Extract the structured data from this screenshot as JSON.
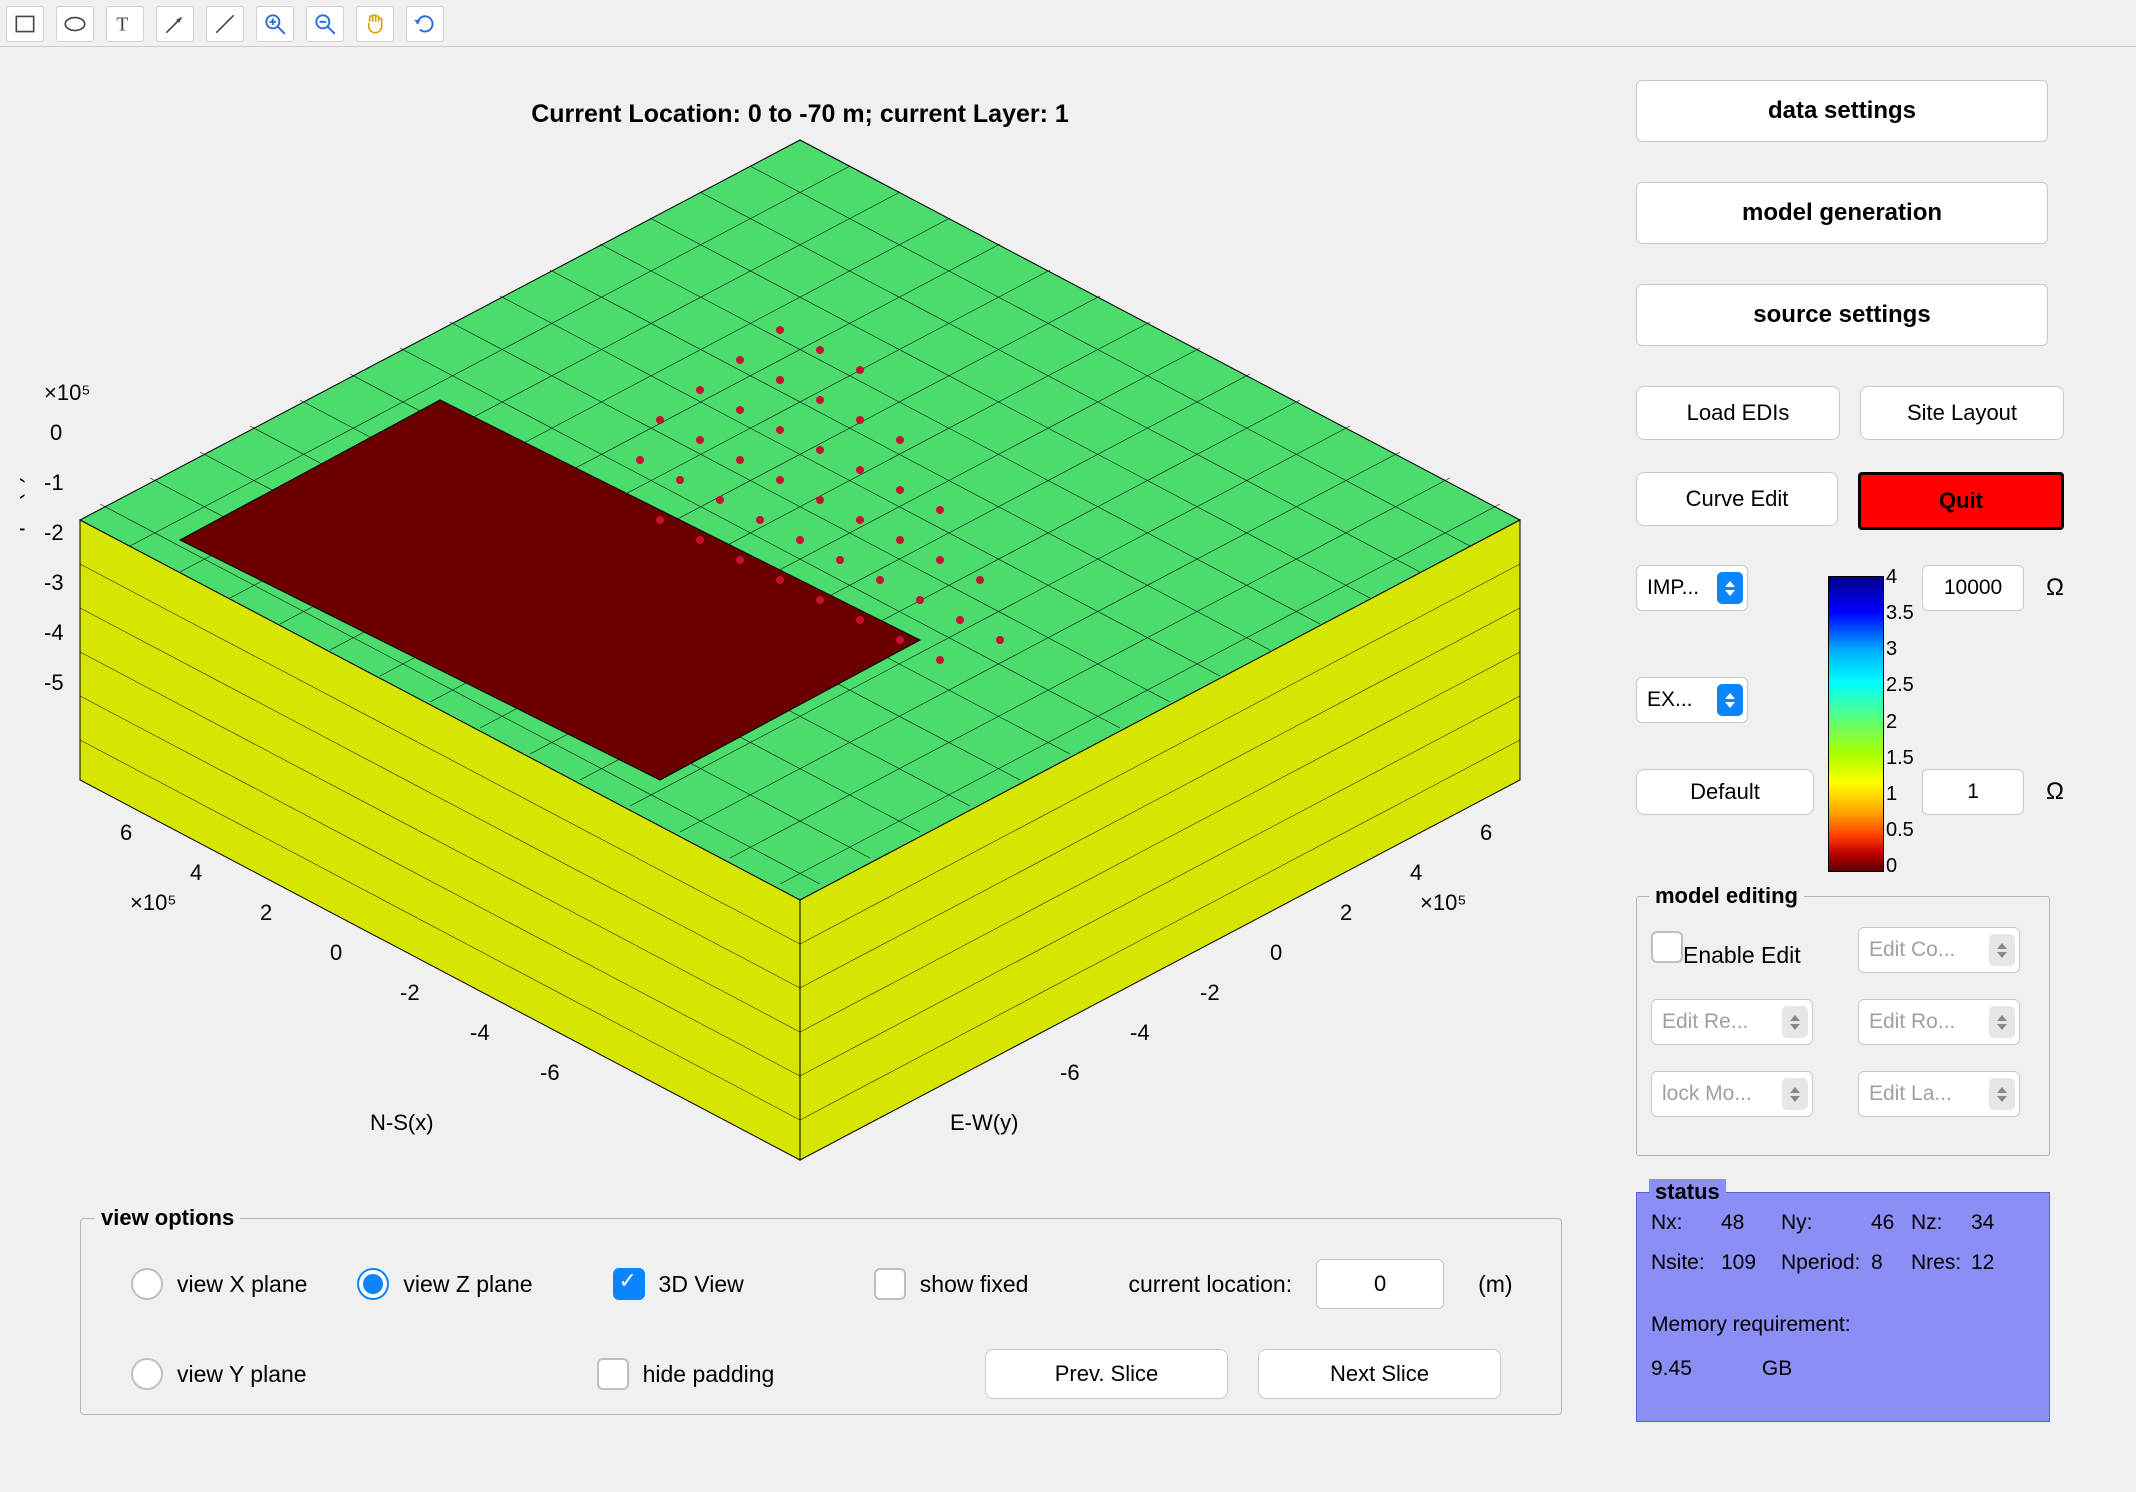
{
  "title": "Current Location: 0 to -70 m; current Layer: 1",
  "axes": {
    "z_label": "Depth(z)",
    "z_exp": "×10⁵",
    "z_ticks": [
      "0",
      "-1",
      "-2",
      "-3",
      "-4",
      "-5"
    ],
    "x_label": "N-S(x)",
    "x_exp": "×10⁵",
    "x_ticks": [
      "6",
      "4",
      "2",
      "0",
      "-2",
      "-4",
      "-6"
    ],
    "y_label": "E-W(y)",
    "y_exp": "×10⁵",
    "y_ticks": [
      "-6",
      "-4",
      "-2",
      "0",
      "2",
      "4",
      "6"
    ]
  },
  "toolbar_icons": [
    "rect",
    "ellipse",
    "text",
    "arrow",
    "line",
    "zoom-in",
    "zoom-out",
    "pan",
    "restore"
  ],
  "view_options": {
    "legend": "view options",
    "view_x": "view X plane",
    "view_y": "view Y plane",
    "view_z": "view Z plane",
    "view_3d": "3D View",
    "show_fixed": "show fixed",
    "hide_padding": "hide padding",
    "current_location_label": "current location:",
    "current_location_value": "0",
    "current_location_unit": "(m)",
    "prev_slice": "Prev. Slice",
    "next_slice": "Next Slice",
    "selected_plane": "z",
    "view_3d_checked": true,
    "show_fixed_checked": false,
    "hide_padding_checked": false
  },
  "right": {
    "data_settings": "data settings",
    "model_generation": "model generation",
    "source_settings": "source settings",
    "load_edis": "Load EDIs",
    "site_layout": "Site Layout",
    "curve_edit": "Curve Edit",
    "quit": "Quit",
    "imp_label": "IMP...",
    "exp_label": "EX...",
    "default_btn": "Default",
    "upper_value": "10000",
    "lower_value": "1",
    "ohm": "Ω"
  },
  "colorbar_ticks": [
    "4",
    "3.5",
    "3",
    "2.5",
    "2",
    "1.5",
    "1",
    "0.5",
    "0"
  ],
  "model_editing": {
    "legend": "model editing",
    "enable_edit": "Enable Edit",
    "edit_co": "Edit Co...",
    "edit_re": "Edit Re...",
    "edit_ro": "Edit Ro...",
    "lock_mo": "lock Mo...",
    "edit_la": "Edit La..."
  },
  "status": {
    "legend": "status",
    "nx_label": "Nx:",
    "nx": "48",
    "ny_label": "Ny:",
    "ny": "46",
    "nz_label": "Nz:",
    "nz": "34",
    "nsite_label": "Nsite:",
    "nsite": "109",
    "nperiod_label": "Nperiod:",
    "nperiod": "8",
    "nres_label": "Nres:",
    "nres": "12",
    "mem_label": "Memory requirement:",
    "mem_val": "9.45",
    "mem_unit": "GB"
  },
  "chart_data": {
    "type": "heatmap",
    "title": "Current Location: 0 to -70 m; current Layer: 1",
    "xlabel": "N-S(x)",
    "ylabel": "E-W(y)",
    "zlabel": "Depth(z)",
    "x_range_exp5": [
      -6,
      6
    ],
    "y_range_exp5": [
      -6,
      6
    ],
    "z_range_exp5": [
      -5.5,
      0
    ],
    "color_scale_log10_res": [
      0,
      4
    ],
    "displayed_layer": 1,
    "layer_depth_m": [
      0,
      -70
    ],
    "approx_regions": [
      {
        "name": "top-surface-green",
        "log10_res_approx": 2
      },
      {
        "name": "dark-red-block",
        "log10_res_approx": 0
      },
      {
        "name": "yellow-body",
        "log10_res_approx": 1.5
      }
    ],
    "station_markers_count_approx": 109
  }
}
